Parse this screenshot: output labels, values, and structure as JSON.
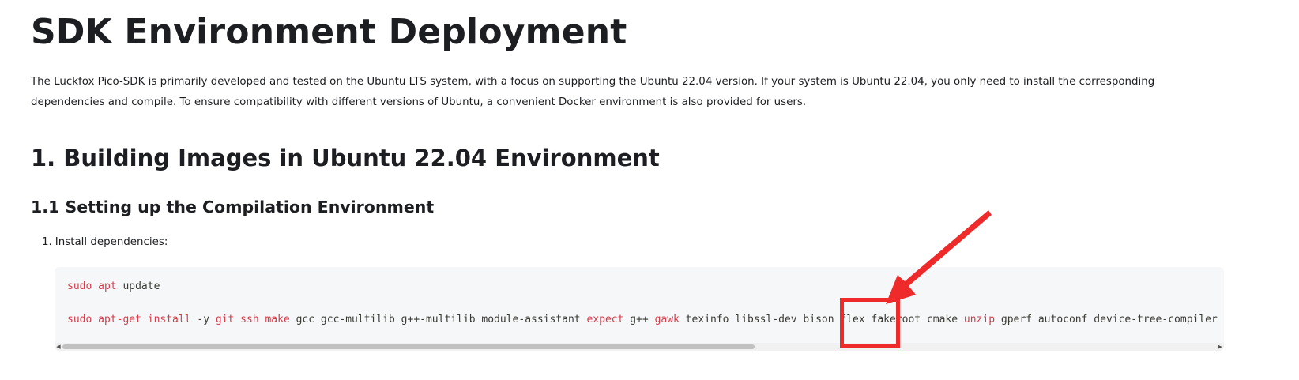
{
  "title": "SDK Environment Deployment",
  "intro": "The Luckfox Pico-SDK is primarily developed and tested on the Ubuntu LTS system, with a focus on supporting the Ubuntu 22.04 version. If your system is Ubuntu 22.04, you only need to install the corresponding dependencies and compile. To ensure compatibility with different versions of Ubuntu, a convenient Docker environment is also provided for users.",
  "section_heading": "1. Building Images in Ubuntu 22.04 Environment",
  "subsection_heading": "1.1 Setting up the Compilation Environment",
  "steps": [
    {
      "number": "1.",
      "text": "Install dependencies:"
    }
  ],
  "code": {
    "lines": [
      [
        {
          "text": "sudo apt",
          "highlight": true
        },
        {
          "text": " update",
          "highlight": false
        }
      ],
      [
        {
          "text": "sudo apt-get install",
          "highlight": true
        },
        {
          "text": " -y ",
          "highlight": false
        },
        {
          "text": "git ssh make",
          "highlight": true
        },
        {
          "text": " gcc gcc-multilib g++-multilib module-assistant ",
          "highlight": false
        },
        {
          "text": "expect",
          "highlight": true
        },
        {
          "text": " g++ ",
          "highlight": false
        },
        {
          "text": "gawk",
          "highlight": true
        },
        {
          "text": " texinfo libssl-dev bison flex fakeroot cmake ",
          "highlight": false
        },
        {
          "text": "unzip",
          "highlight": true
        },
        {
          "text": " gperf autoconf device-tree-compiler",
          "highlight": false
        }
      ]
    ],
    "scroll_fraction_visible": 0.6
  },
  "annotation": {
    "color": "#ee2a2a",
    "target": "flex"
  },
  "scroll_icons": {
    "left": "scroll-left-arrow-icon",
    "right": "scroll-right-arrow-icon"
  }
}
